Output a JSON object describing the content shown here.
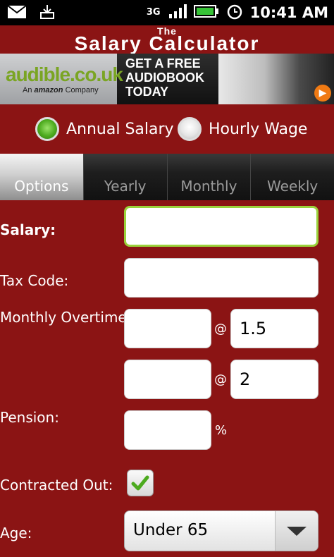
{
  "status_bar": {
    "network": "3G",
    "time": "10:41 AM",
    "icons": [
      "mail-icon",
      "download-icon",
      "signal-icon",
      "battery-icon",
      "alarm-icon"
    ]
  },
  "header": {
    "title_small": "The",
    "title_main": "Salary Calculator"
  },
  "ad": {
    "brand": "audible.co.uk",
    "brand_sub_prefix": "An",
    "brand_sub_company": "amazon",
    "brand_sub_suffix": "Company",
    "line1": "GET A FREE",
    "line2": "AUDIOBOOK",
    "line3": "TODAY"
  },
  "mode": {
    "options": [
      {
        "label": "Annual Salary",
        "selected": true
      },
      {
        "label": "Hourly Wage",
        "selected": false
      }
    ]
  },
  "tabs": [
    {
      "label": "Options",
      "active": true
    },
    {
      "label": "Yearly",
      "active": false
    },
    {
      "label": "Monthly",
      "active": false
    },
    {
      "label": "Weekly",
      "active": false
    }
  ],
  "form": {
    "salary_label": "Salary:",
    "salary_value": "",
    "tax_code_label": "Tax Code:",
    "tax_code_value": "",
    "overtime_label": "Monthly Overtime:",
    "overtime1_hours": "",
    "overtime1_rate": "1.5",
    "overtime2_hours": "",
    "overtime2_rate": "2",
    "at_symbol": "@",
    "pension_label": "Pension:",
    "pension_value": "",
    "percent_symbol": "%",
    "contracted_out_label": "Contracted Out:",
    "contracted_out_checked": true,
    "age_label": "Age:",
    "age_value": "Under 65"
  },
  "colors": {
    "background": "#8b1414",
    "accent_green": "#4caa1e",
    "focus_border": "#9ad23b"
  }
}
